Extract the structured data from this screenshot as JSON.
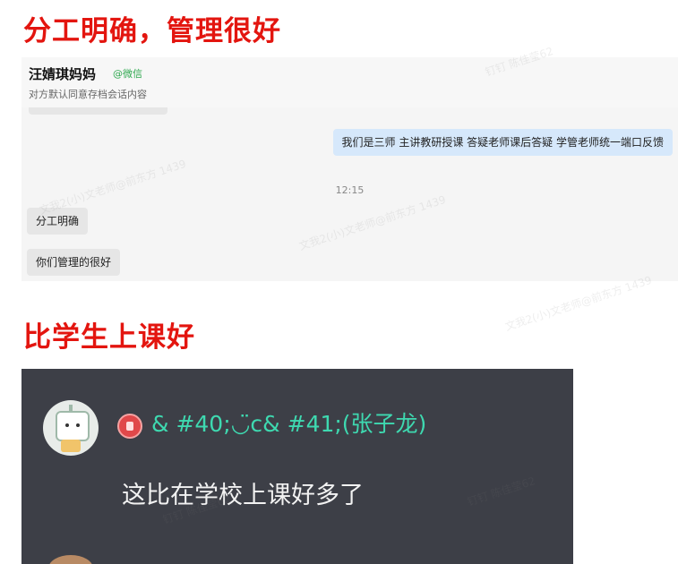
{
  "headings": {
    "top": "分工明确，管理很好",
    "bottom": "比学生上课好"
  },
  "chat1": {
    "contact_name": "汪婧琪妈妈",
    "contact_tag": "@微信",
    "consent_notice": "对方默认同意存档会话内容",
    "messages": [
      {
        "direction": "out",
        "text": "我们是三师  主讲教研授课  答疑老师课后答疑  学管老师统一端口反馈"
      },
      {
        "direction": "time",
        "text": "12:15"
      },
      {
        "direction": "in",
        "text": "分工明确"
      },
      {
        "direction": "in",
        "text": "你们管理的很好"
      }
    ]
  },
  "chat2": {
    "sender_name": "& #40;◡̈c& #41;(张子龙)",
    "message": "这比在学校上课好多了",
    "icons": {
      "avatar": "robot-avatar-icon",
      "badge": "rank-badge-icon"
    }
  },
  "watermarks": [
    "文我2(小)文老师@前东方 1439",
    "钉钉 陈佳莹62"
  ],
  "colors": {
    "heading": "#e3150f",
    "sender_name": "#3ed9b0",
    "dark_bg": "#3d3f47",
    "out_bubble": "#d6e8fb"
  }
}
